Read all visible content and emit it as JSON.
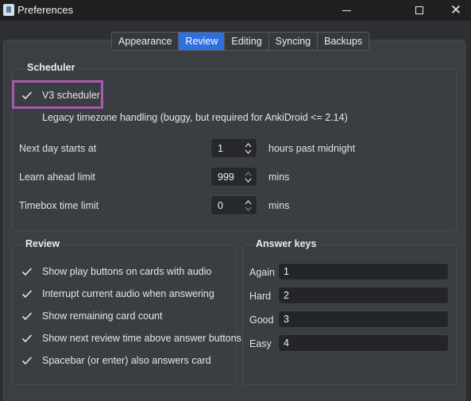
{
  "window": {
    "title": "Preferences",
    "icon": "anki-app-icon",
    "controls": [
      "minimize-icon",
      "maximize-icon",
      "close-icon"
    ]
  },
  "tabs": [
    {
      "label": "Appearance",
      "active": false
    },
    {
      "label": "Review",
      "active": true
    },
    {
      "label": "Editing",
      "active": false
    },
    {
      "label": "Syncing",
      "active": false
    },
    {
      "label": "Backups",
      "active": false
    }
  ],
  "scheduler": {
    "title": "Scheduler",
    "v3": {
      "label": "V3 scheduler",
      "checked": true
    },
    "legacy_tz": {
      "label": "Legacy timezone handling (buggy, but required for AnkiDroid <= 2.14)",
      "checked": false
    },
    "next_day": {
      "label": "Next day starts at",
      "value": "1",
      "suffix": "hours past midnight"
    },
    "learn_ahead": {
      "label": "Learn ahead limit",
      "value": "999",
      "suffix": "mins"
    },
    "timebox": {
      "label": "Timebox time limit",
      "value": "0",
      "suffix": "mins"
    }
  },
  "review": {
    "title": "Review",
    "options": [
      {
        "label": "Show play buttons on cards with audio",
        "checked": true
      },
      {
        "label": "Interrupt current audio when answering",
        "checked": true
      },
      {
        "label": "Show remaining card count",
        "checked": true
      },
      {
        "label": "Show next review time above answer buttons",
        "checked": true
      },
      {
        "label": "Spacebar (or enter) also answers card",
        "checked": true
      }
    ]
  },
  "answer_keys": {
    "title": "Answer keys",
    "keys": [
      {
        "label": "Again",
        "value": "1"
      },
      {
        "label": "Hard",
        "value": "2"
      },
      {
        "label": "Good",
        "value": "3"
      },
      {
        "label": "Easy",
        "value": "4"
      }
    ]
  },
  "colors": {
    "accent": "#2f6fe0",
    "highlight": "#a65cb0",
    "background": "#2d2f33"
  }
}
